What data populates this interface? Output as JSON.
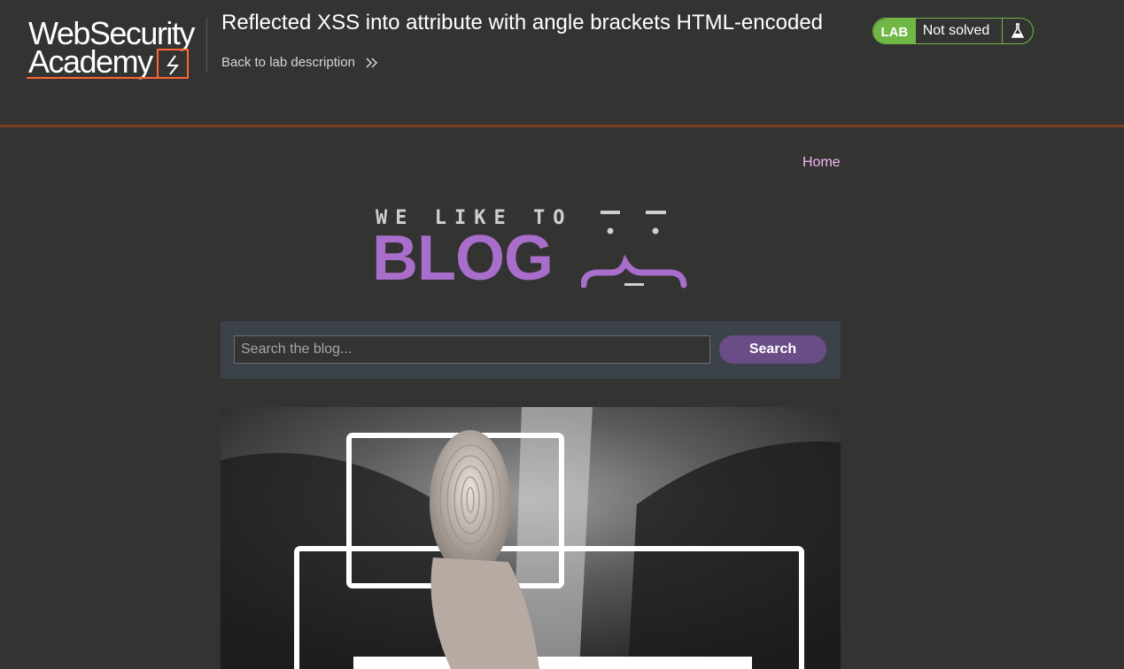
{
  "header": {
    "logo_line1": "WebSecurity",
    "logo_line2": "Academy",
    "lab_title": "Reflected XSS into attribute with angle brackets HTML-encoded",
    "back_link": "Back to lab description",
    "status": {
      "badge": "LAB",
      "text": "Not solved",
      "icon": "flask-icon",
      "color": "#70b745"
    },
    "accent_border": "#7a3e22"
  },
  "nav": {
    "home": "Home"
  },
  "banner": {
    "line1": "WE LIKE TO",
    "line2": "BLOG"
  },
  "search": {
    "placeholder": "Search the blog...",
    "value": "",
    "button": "Search"
  },
  "post": {
    "image_subject": "thumb pressing fingerprint on security screen"
  }
}
